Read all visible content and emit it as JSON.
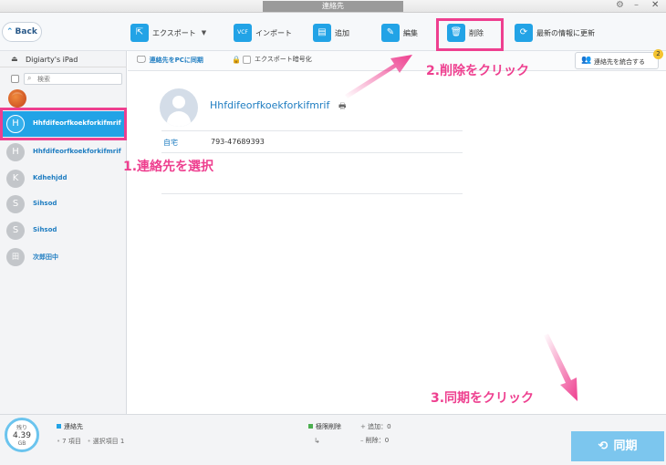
{
  "window": {
    "title": "連絡先",
    "gear_icon": "⚙",
    "minimize_icon": "–",
    "close_icon": "✕"
  },
  "toolbar": {
    "back_label": "Back",
    "export_label": "エクスポート",
    "import_label": "インポート",
    "add_label": "追加",
    "edit_label": "編集",
    "delete_label": "削除",
    "refresh_label": "最新の情報に更新"
  },
  "sidebar": {
    "device_name": "Digiarty's iPad",
    "search_placeholder": "検索",
    "contacts": [
      {
        "initial": "H",
        "name": "Hhfdifeorfkoekforkifmrif",
        "selected": true
      },
      {
        "initial": "H",
        "name": "Hhfdifeorfkoekforkifmrif",
        "selected": false
      },
      {
        "initial": "K",
        "name": "Kdhehjdd",
        "selected": false
      },
      {
        "initial": "S",
        "name": "Sihsod",
        "selected": false
      },
      {
        "initial": "S",
        "name": "Sihsod",
        "selected": false
      },
      {
        "initial": "田",
        "name": "次郎田中",
        "selected": false
      }
    ]
  },
  "content_bar": {
    "sync_pc_label": "連絡先をPCに同期",
    "encrypt_label": "エクスポート暗号化",
    "merge_label": "連絡先を統合する",
    "merge_badge": "2"
  },
  "detail": {
    "name": "Hhfdifeorfkoekforkifmrif",
    "phone_label": "自宅",
    "phone_value": "793-47689393"
  },
  "annotations": {
    "step1": "1.連絡先を選択",
    "step2": "2.削除をクリック",
    "step3": "3.同期をクリック",
    "color": "#ee3f8f"
  },
  "status": {
    "storage_label": "残り",
    "storage_value": "4.39",
    "storage_unit": "GB",
    "category": "連絡先",
    "items": "7 項目",
    "selected": "選択項目 1",
    "delete_mark": "極限削除",
    "added": "追加：0",
    "deleted": "削除：0",
    "sync_label": "同期"
  },
  "colors": {
    "accent": "#22a3e6",
    "link": "#1f7dc1"
  }
}
